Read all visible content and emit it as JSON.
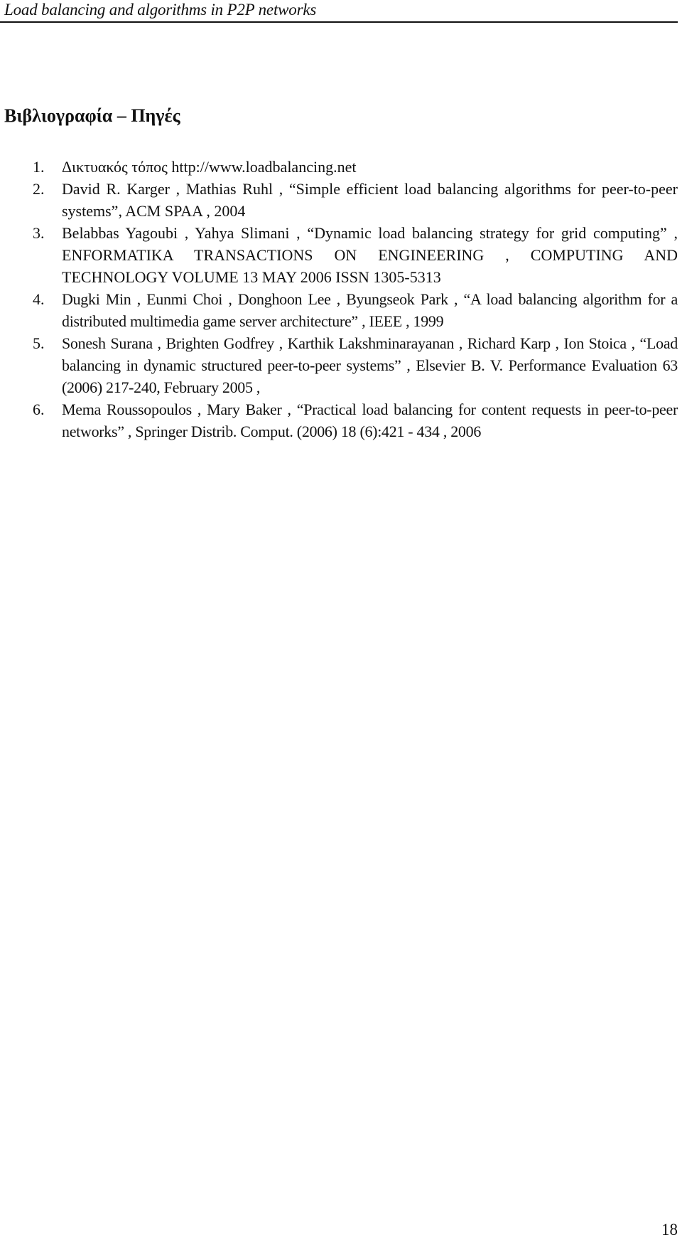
{
  "header": {
    "running_title": "Load balancing and algorithms in P2P networks"
  },
  "section": {
    "title": "Βιβλιογραφία – Πηγές"
  },
  "references": [
    {
      "number": "1.",
      "text": "Δικτυακός τόπος http://www.loadbalancing.net"
    },
    {
      "number": "2.",
      "text": "David R. Karger , Mathias Ruhl , “Simple efficient load balancing algorithms for peer-to-peer systems”, ACM SPAA , 2004"
    },
    {
      "number": "3.",
      "text": "Belabbas Yagoubi , Yahya Slimani , “Dynamic load balancing strategy for grid computing” , ENFORMATIKA TRANSACTIONS ON ENGINEERING , COMPUTING AND TECHNOLOGY VOLUME 13 MAY 2006 ISSN 1305-5313"
    },
    {
      "number": "4.",
      "text": "Dugki Min , Eunmi Choi , Donghoon Lee , Byungseok Park , “A load balancing algorithm for a distributed multimedia game server architecture” , IEEE , 1999"
    },
    {
      "number": "5.",
      "text": "Sonesh Surana , Brighten Godfrey , Karthik Lakshminarayanan , Richard Karp , Ion Stoica , “Load balancing in dynamic structured peer-to-peer systems” , Elsevier B. V. Performance Evaluation 63 (2006) 217-240, February 2005 ,"
    },
    {
      "number": "6.",
      "text": "Mema Roussopoulos , Mary Baker , “Practical load balancing for content requests in peer-to-peer networks” , Springer Distrib. Comput. (2006) 18 (6):421 - 434 , 2006"
    }
  ],
  "footer": {
    "page_number": "18"
  }
}
